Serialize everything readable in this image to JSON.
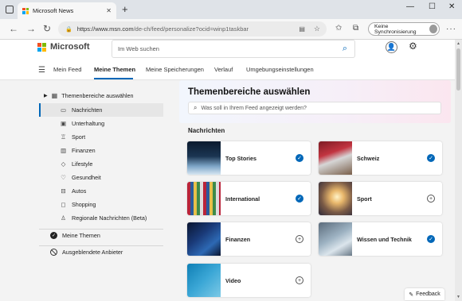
{
  "browser": {
    "tab_title": "Microsoft News",
    "tab_close": "✕",
    "new_tab": "+",
    "url_host": "https://www.msn.com",
    "url_path": "/de-ch/feed/personalize?ocid=winp1taskbar",
    "sync_label": "Keine Synchronisierung",
    "window_controls": [
      "—",
      "☐",
      "✕"
    ]
  },
  "header": {
    "brand": "Microsoft",
    "search_placeholder": "Im Web suchen"
  },
  "nav": {
    "items": [
      {
        "label": "Mein Feed"
      },
      {
        "label": "Meine Themen"
      },
      {
        "label": "Meine Speicherungen"
      },
      {
        "label": "Verlauf"
      },
      {
        "label": "Umgebungseinstellungen"
      }
    ],
    "active": "Meine Themen"
  },
  "sidebar": {
    "heading": "Themenbereiche auswählen",
    "items": [
      {
        "label": "Nachrichten",
        "icon": "news-icon"
      },
      {
        "label": "Unterhaltung",
        "icon": "film-icon"
      },
      {
        "label": "Sport",
        "icon": "trophy-icon"
      },
      {
        "label": "Finanzen",
        "icon": "chart-icon"
      },
      {
        "label": "Lifestyle",
        "icon": "diamond-icon"
      },
      {
        "label": "Gesundheit",
        "icon": "heart-icon"
      },
      {
        "label": "Autos",
        "icon": "car-icon"
      },
      {
        "label": "Shopping",
        "icon": "bag-icon"
      },
      {
        "label": "Regionale Nachrichten (Beta)",
        "icon": "person-icon"
      }
    ],
    "active": "Nachrichten",
    "my_topics": "Meine Themen",
    "hidden_providers": "Ausgeblendete Anbieter"
  },
  "main": {
    "title": "Themenbereiche auswählen",
    "search_placeholder": "Was soll in Ihrem Feed angezeigt werden?",
    "section": "Nachrichten",
    "cards": [
      {
        "label": "Top Stories",
        "followed": true
      },
      {
        "label": "Schweiz",
        "followed": true
      },
      {
        "label": "International",
        "followed": true
      },
      {
        "label": "Sport",
        "followed": false
      },
      {
        "label": "Finanzen",
        "followed": false
      },
      {
        "label": "Wissen und Technik",
        "followed": true
      },
      {
        "label": "Video",
        "followed": false
      }
    ]
  },
  "feedback": "Feedback",
  "colors": {
    "accent": "#0067b8"
  }
}
